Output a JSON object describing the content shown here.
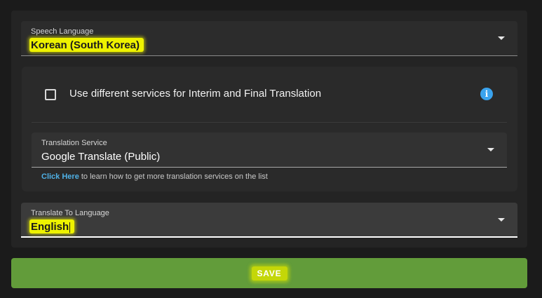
{
  "speech_language": {
    "label": "Speech Language",
    "value": "Korean (South Korea)"
  },
  "translation_card": {
    "checkbox_label": "Use different services for Interim and Final Translation",
    "checkbox_checked": false,
    "info_icon": "info-icon",
    "service": {
      "label": "Translation Service",
      "value": "Google Translate (Public)"
    },
    "help": {
      "link_text": "Click Here",
      "text": " to learn how to get more translation services on the list"
    }
  },
  "target_language": {
    "label": "Translate To Language",
    "value": "English"
  },
  "save_button": {
    "label": "SAVE"
  },
  "colors": {
    "background": "#1b1b1b",
    "panel": "#242424",
    "accent_link": "#4fb1e6",
    "info_icon": "#3aa3ee",
    "save_button": "#629c3a",
    "highlight": "#eef200"
  }
}
